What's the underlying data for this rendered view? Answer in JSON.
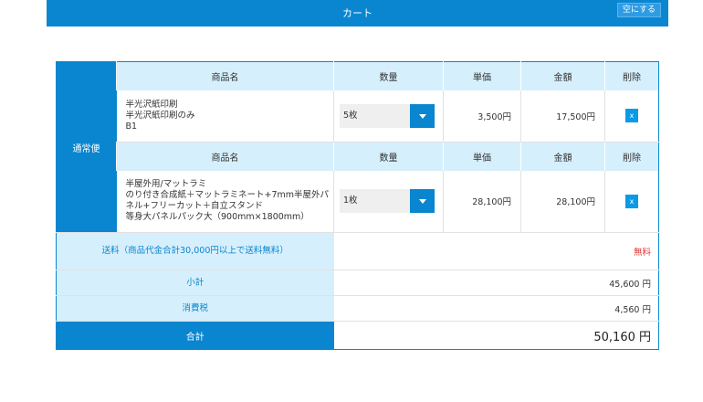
{
  "header": {
    "title": "カート",
    "empty_button": "空にする"
  },
  "shipping_type": "通常便",
  "columns": {
    "name": "商品名",
    "qty": "数量",
    "unit_price": "単価",
    "amount": "金額",
    "delete": "削除"
  },
  "items": [
    {
      "name_lines": [
        "半光沢紙印刷",
        "半光沢紙印刷のみ",
        "B1"
      ],
      "qty": "5枚",
      "unit_price": "3,500円",
      "amount": "17,500円",
      "delete_label": "x"
    },
    {
      "name_lines": [
        "半屋外用/マットラミ",
        "のり付き合成紙＋マットラミネート+7mm半屋外パ",
        "ネル+フリーカット＋自立スタンド",
        "等身大パネルパック大（900mm×1800mm）"
      ],
      "qty": "1枚",
      "unit_price": "28,100円",
      "amount": "28,100円",
      "delete_label": "x"
    }
  ],
  "summary": {
    "shipping_label": "送料（商品代金合計30,000円以上で送料無料）",
    "shipping_value": "無料",
    "subtotal_label": "小計",
    "subtotal_value": "45,600 円",
    "tax_label": "消費税",
    "tax_value": "4,560 円",
    "total_label": "合計",
    "total_value": "50,160 円"
  },
  "colors": {
    "primary": "#0a86d0",
    "header_cell": "#d6effc",
    "free": "#e53935"
  }
}
